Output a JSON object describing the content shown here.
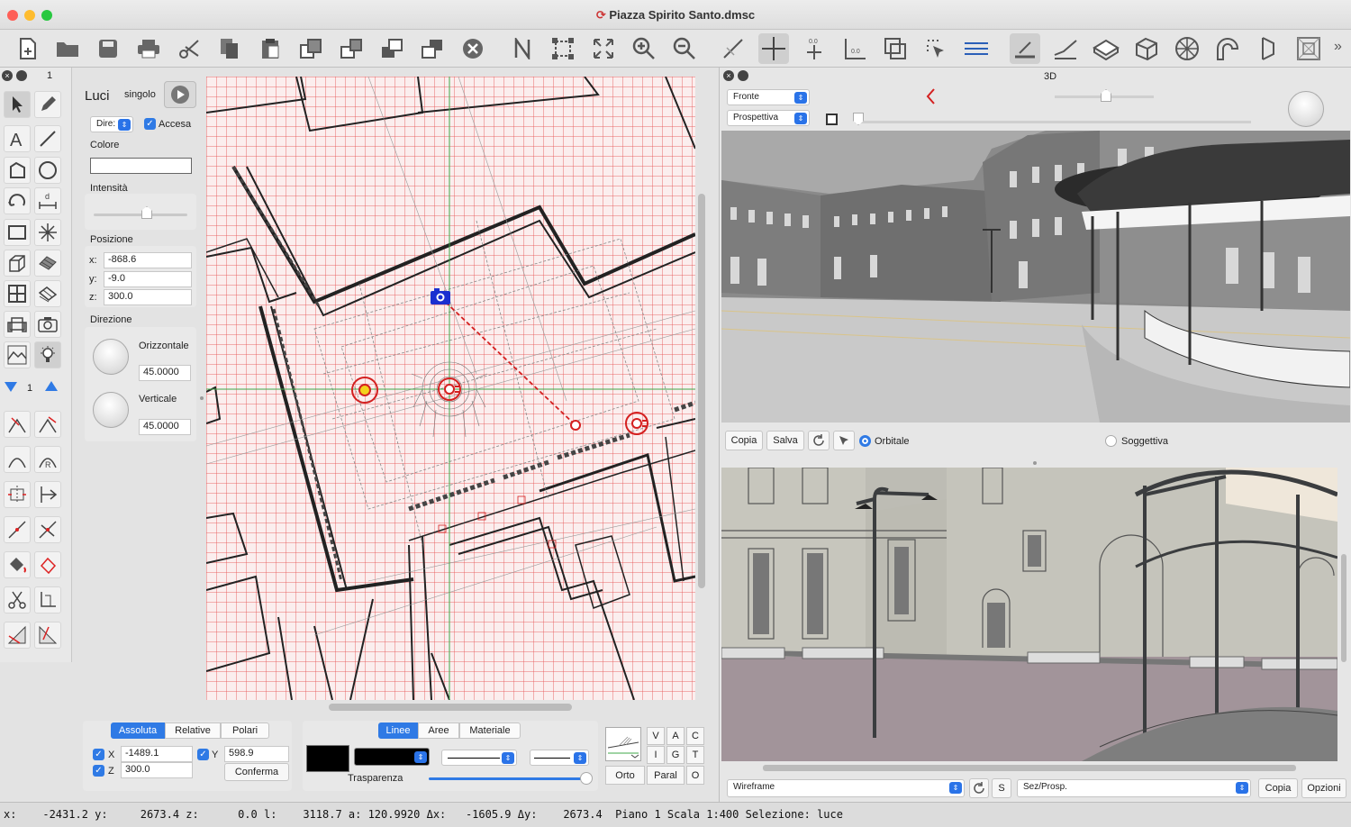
{
  "window": {
    "title": "Piazza Spirito Santo.dmsc"
  },
  "tools_panel": {
    "layer_num": "1",
    "step_num": "1"
  },
  "props": {
    "heading": "Luci",
    "mode": "singolo",
    "type_select": "Dire:",
    "on_label": "Accesa",
    "color_label": "Colore",
    "intensity_label": "Intensità",
    "position_label": "Posizione",
    "x_label": "x:",
    "x": "-868.6",
    "y_label": "y:",
    "y": "-9.0",
    "z_label": "z:",
    "z": "300.0",
    "direction_label": "Direzione",
    "horizontal_label": "Orizzontale",
    "horizontal": "45.0000",
    "vertical_label": "Verticale",
    "vertical": "45.0000"
  },
  "view3d": {
    "label": "3D",
    "view_select": "Fronte",
    "projection_select": "Prospettiva",
    "copy_btn": "Copia",
    "save_btn": "Salva",
    "orbital": "Orbitale",
    "subjective": "Soggettiva"
  },
  "view_lower": {
    "render_select": "Wireframe",
    "s_btn": "S",
    "section_select": "Sez/Prosp.",
    "copy_btn": "Copia",
    "options_btn": "Opzioni"
  },
  "coords": {
    "tabs": [
      "Assoluta",
      "Relative",
      "Polari"
    ],
    "x_label": "X",
    "x": "-1489.1",
    "y_label": "Y",
    "y": "598.9",
    "z_label": "Z",
    "z": "300.0",
    "confirm": "Conferma"
  },
  "lines": {
    "tabs": [
      "Linee",
      "Aree",
      "Materiale"
    ],
    "transparency": "Trasparenza"
  },
  "snap": {
    "grid": [
      [
        "V",
        "A",
        "C"
      ],
      [
        "I",
        "G",
        "T"
      ]
    ],
    "orto": "Orto",
    "paral": "Paral",
    "o": "O"
  },
  "status": {
    "text": "x:    -2431.2 y:     2673.4 z:      0.0 l:    3118.7 a: 120.9920 Δx:   -1605.9 Δy:    2673.4  Piano 1 Scala 1:400 Selezione: luce"
  },
  "colors": {
    "accent": "#2f7ae5",
    "grid": "#e65a5a",
    "light": "#d42020",
    "camera": "#1a2fd0"
  }
}
